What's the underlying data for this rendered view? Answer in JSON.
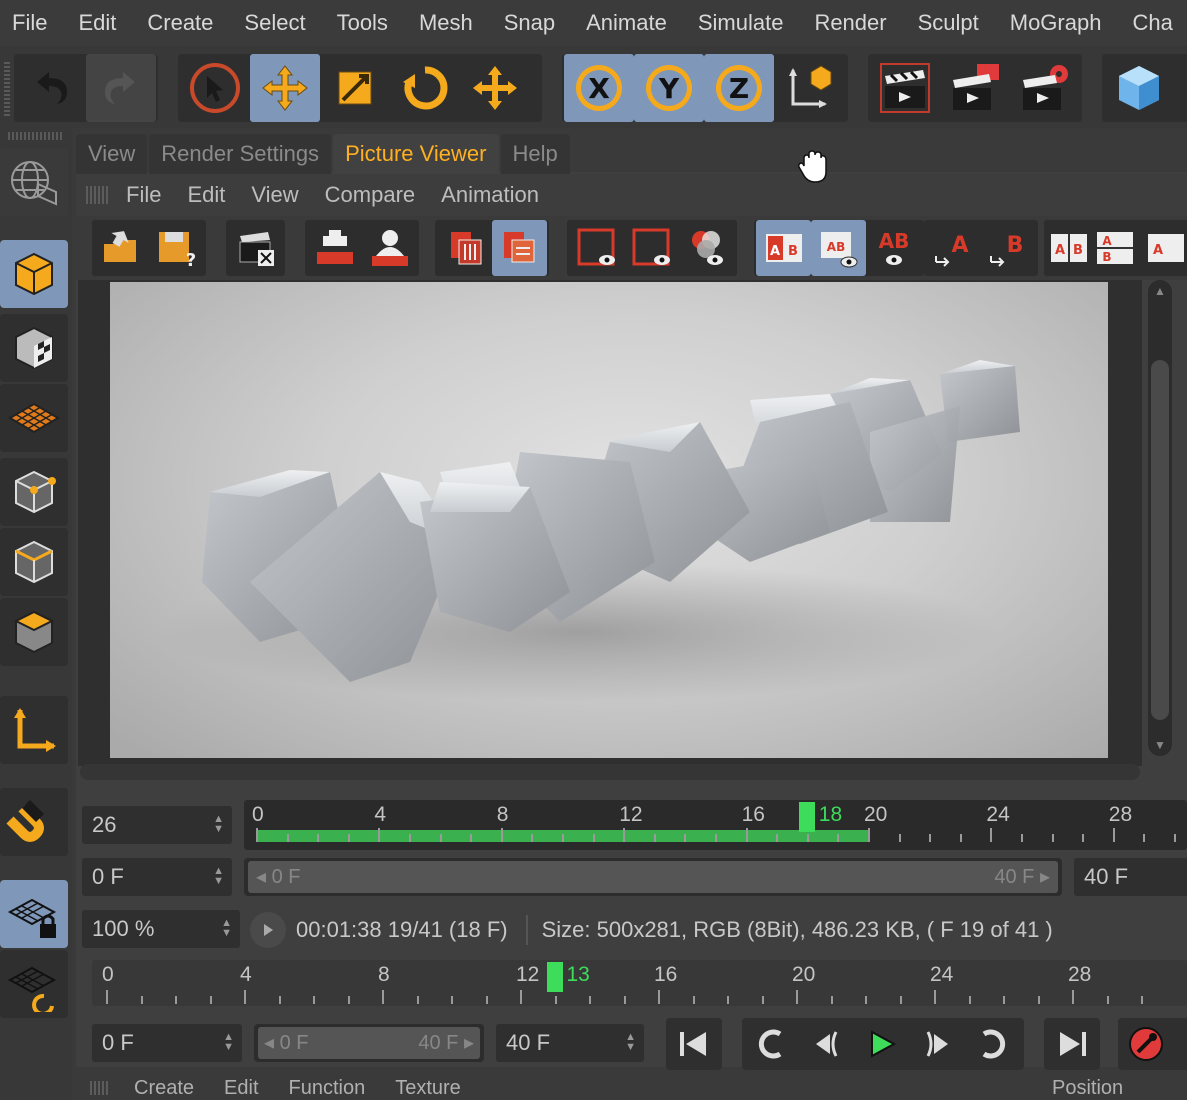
{
  "menubar": {
    "items": [
      "File",
      "Edit",
      "Create",
      "Select",
      "Tools",
      "Mesh",
      "Snap",
      "Animate",
      "Simulate",
      "Render",
      "Sculpt",
      "MoGraph",
      "Cha"
    ]
  },
  "axis_labels": {
    "x": "X",
    "y": "Y",
    "z": "Z"
  },
  "tabs": [
    "View",
    "Render Settings",
    "Picture Viewer",
    "Help"
  ],
  "active_tab": "Picture Viewer",
  "pv_menu": [
    "File",
    "Edit",
    "View",
    "Compare",
    "Animation"
  ],
  "pv_toolbar_labels": {
    "ab": "AB",
    "a": "A",
    "b": "B"
  },
  "timeline1": {
    "field": "26",
    "ticks": [
      "0",
      "4",
      "8",
      "12",
      "16",
      "20",
      "24",
      "28"
    ],
    "current": "18",
    "start_field": "0 F",
    "range_start": "0 F",
    "range_end": "40 F",
    "end_field": "40 F"
  },
  "zoom": "100 %",
  "status": {
    "time": "00:01:38 19/41 (18 F)",
    "info": "Size: 500x281, RGB (8Bit), 486.23 KB,  ( F 19 of 41 )"
  },
  "timeline2": {
    "ticks": [
      "0",
      "4",
      "8",
      "12",
      "16",
      "20",
      "24",
      "28"
    ],
    "current": "13",
    "start_field": "0 F",
    "range_start": "0 F",
    "range_end": "40 F",
    "end_field": "40 F"
  },
  "bottom_panel": {
    "items": [
      "Create",
      "Edit",
      "Function",
      "Texture"
    ],
    "right": "Position"
  },
  "colors": {
    "accent_orange": "#ffb020",
    "active_blue": "#7f97b8",
    "playhead_green": "#3ddc5a",
    "record_red": "#e03a3a"
  }
}
